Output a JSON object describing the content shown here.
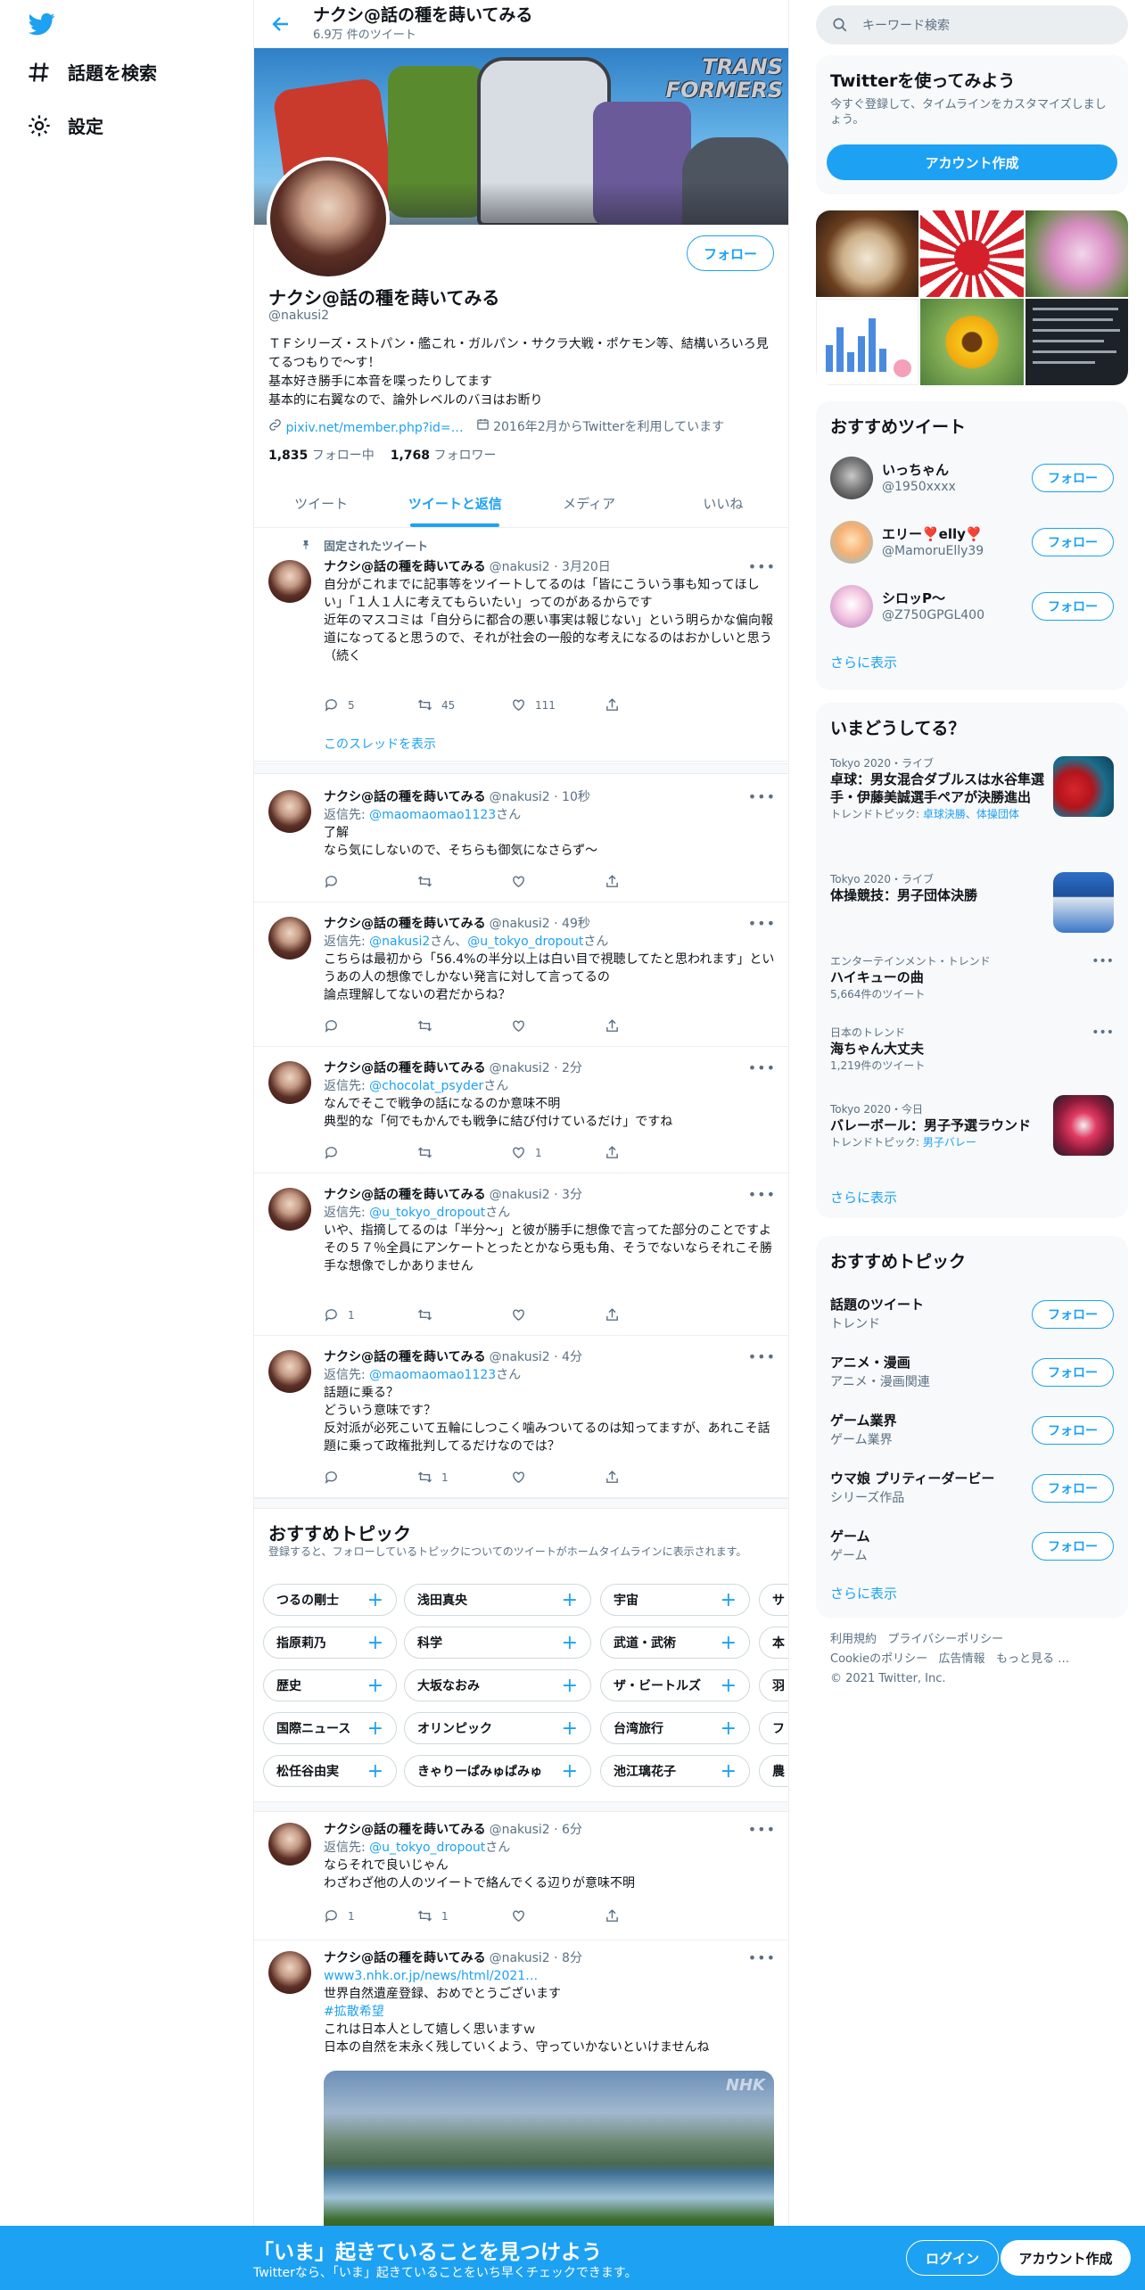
{
  "nav": {
    "explore": "話題を検索",
    "settings": "設定"
  },
  "header": {
    "title": "ナクシ@話の種を蒔いてみる",
    "tweet_count": "6.9万 件のツイート"
  },
  "banner": {
    "logo_line1": "TRANS",
    "logo_line2": "FORMERS"
  },
  "profile": {
    "follow": "フォロー",
    "name": "ナクシ@話の種を蒔いてみる",
    "handle": "@nakusi2",
    "bio": "ＴＦシリーズ・ストパン・艦これ・ガルパン・サクラ大戦・ポケモン等、結構いろいろ見てるつもりで～す！\n基本好き勝手に本音を喋ったりしてます\n基本的に右翼なので、論外レベルのバヨはお断り",
    "link": "pixiv.net/member.php?id=…",
    "joined": "2016年2月からTwitterを利用しています",
    "following_count": "1,835",
    "following_label": "フォロー中",
    "followers_count": "1,768",
    "followers_label": "フォロワー"
  },
  "tabs": [
    "ツイート",
    "ツイートと返信",
    "メディア",
    "いいね"
  ],
  "pinned_label": "固定されたツイート",
  "tweets": [
    {
      "name": "ナクシ@話の種を蒔いてみる",
      "meta": "@nakusi2 · 3月20日",
      "reply_to_label": "",
      "reply_to": "",
      "reply_suffix": "",
      "text": "自分がこれまでに記事等をツイートしてるのは「皆にこういう事も知ってほしい」「１人１人に考えてもらいたい」ってのがあるからです\n近年のマスコミは「自分らに都合の悪い事実は報じない」という明らかな偏向報道になってると思うので、それが社会の一般的な考えになるのはおかしいと思う\n（続く",
      "replies": "5",
      "retweets": "45",
      "likes": "111",
      "thread_link": "このスレッドを表示"
    },
    {
      "name": "ナクシ@話の種を蒔いてみる",
      "meta": "@nakusi2 · 10秒",
      "reply_to_label": "返信先: ",
      "reply_to": "@maomaomao1123",
      "reply_suffix": "さん",
      "text": "了解\nなら気にしないので、そちらも御気になさらず～",
      "replies": "",
      "retweets": "",
      "likes": ""
    },
    {
      "name": "ナクシ@話の種を蒔いてみる",
      "meta": "@nakusi2 · 49秒",
      "reply_to_label": "返信先: ",
      "reply_to": "@nakusi2",
      "reply_suffix": "さん、",
      "reply_to2": "@u_tokyo_dropout",
      "reply_suffix2": "さん",
      "text": "こちらは最初から「56.4%の半分以上は白い目で視聴してたと思われます」というあの人の想像でしかない発言に対して言ってるの\n論点理解してないの君だからね？",
      "replies": "",
      "retweets": "",
      "likes": ""
    },
    {
      "name": "ナクシ@話の種を蒔いてみる",
      "meta": "@nakusi2 · 2分",
      "reply_to_label": "返信先: ",
      "reply_to": "@chocolat_psyder",
      "reply_suffix": "さん",
      "text": "なんでそこで戦争の話になるのか意味不明\n典型的な「何でもかんでも戦争に結び付けているだけ」ですね",
      "replies": "",
      "retweets": "",
      "likes": "1"
    },
    {
      "name": "ナクシ@話の種を蒔いてみる",
      "meta": "@nakusi2 · 3分",
      "reply_to_label": "返信先: ",
      "reply_to": "@u_tokyo_dropout",
      "reply_suffix": "さん",
      "text": "いや、指摘してるのは「半分～」と彼が勝手に想像で言ってた部分のことですよ\nその５７％全員にアンケートとったとかなら兎も角、そうでないならそれこそ勝手な想像でしかありません",
      "replies": "1",
      "retweets": "",
      "likes": ""
    },
    {
      "name": "ナクシ@話の種を蒔いてみる",
      "meta": "@nakusi2 · 4分",
      "reply_to_label": "返信先: ",
      "reply_to": "@maomaomao1123",
      "reply_suffix": "さん",
      "text": "話題に乗る？\nどういう意味です？\n反対派が必死こいて五輪にしつこく噛みついてるのは知ってますが、あれこそ話題に乗って政権批判してるだけなのでは？",
      "replies": "",
      "retweets": "1",
      "likes": ""
    },
    {
      "name": "ナクシ@話の種を蒔いてみる",
      "meta": "@nakusi2 · 6分",
      "reply_to_label": "返信先: ",
      "reply_to": "@u_tokyo_dropout",
      "reply_suffix": "さん",
      "text": "ならそれで良いじゃん\nわざわざ他の人のツイートで絡んでくる辺りが意味不明",
      "replies": "1",
      "retweets": "1",
      "likes": ""
    },
    {
      "name": "ナクシ@話の種を蒔いてみる",
      "meta": "@nakusi2 · 8分",
      "link": "www3.nhk.or.jp/news/html/2021…",
      "hashtag": "#拡散希望",
      "text": "世界自然遺産登録、おめでとうございます",
      "text2": "これは日本人として嬉しく思いますｗ\n日本の自然を末永く残していくよう、守っていかないといけませんね",
      "media_mark": "NHK"
    }
  ],
  "topics": {
    "title": "おすすめトピック",
    "desc": "登録すると、フォローしているトピックについてのツイートがホームタイムラインに表示されます。",
    "rows": [
      [
        "つるの剛士",
        "浅田真央",
        "宇宙",
        "サ"
      ],
      [
        "指原莉乃",
        "科学",
        "武道・武術",
        "本"
      ],
      [
        "歴史",
        "大坂なおみ",
        "ザ・ビートルズ",
        "羽"
      ],
      [
        "国際ニュース",
        "オリンピック",
        "台湾旅行",
        "フ"
      ],
      [
        "松任谷由実",
        "きゃりーぱみゅぱみゅ",
        "池江璃花子",
        "農"
      ]
    ]
  },
  "right": {
    "search_placeholder": "キーワード検索",
    "join": {
      "title": "Twitterを使ってみよう",
      "desc": "今すぐ登録して、タイムラインをカスタマイズしましょう。",
      "button": "アカウント作成"
    },
    "who_title": "おすすめツイート",
    "who": [
      {
        "name": "いっちゃん",
        "handle": "@1950xxxx",
        "follow": "フォロー"
      },
      {
        "name": "エリー❣️elly❣️",
        "handle": "@MamoruElly39",
        "follow": "フォロー"
      },
      {
        "name": "シロッP〜",
        "handle": "@Z750GPGL400",
        "follow": "フォロー"
      }
    ],
    "show_more": "さらに表示",
    "trends_title": "いまどうしてる？",
    "trends": [
      {
        "ctx": "Tokyo 2020・ライブ",
        "title": "卓球：男女混合ダブルスは水谷隼選手・伊藤美誠選手ペアが決勝進出",
        "sub_prefix": "トレンドトピック: ",
        "sub_link": "卓球決勝、体操団体"
      },
      {
        "ctx": "Tokyo 2020・ライブ",
        "title": "体操競技：男子団体決勝",
        "sub_prefix": "",
        "sub_link": ""
      },
      {
        "ctx": "エンターテインメント・トレンド",
        "title": "ハイキューの曲",
        "sub": "5,664件のツイート"
      },
      {
        "ctx": "日本のトレンド",
        "title": "海ちゃん大丈夫",
        "sub": "1,219件のツイート"
      },
      {
        "ctx": "Tokyo 2020・今日",
        "title": "バレーボール：男子予選ラウンド",
        "sub_prefix": "トレンドトピック: ",
        "sub_link": "男子バレー"
      }
    ],
    "topics_title": "おすすめトピック",
    "topics": [
      {
        "name": "話題のツイート",
        "cat": "トレンド"
      },
      {
        "name": "アニメ・漫画",
        "cat": "アニメ・漫画関連"
      },
      {
        "name": "ゲーム業界",
        "cat": "ゲーム業界"
      },
      {
        "name": "ウマ娘 プリティーダービー",
        "cat": "シリーズ作品"
      },
      {
        "name": "ゲーム",
        "cat": "ゲーム"
      }
    ],
    "footer": [
      "利用規約",
      "プライバシーポリシー",
      "Cookieのポリシー",
      "広告情報",
      "もっと見る …",
      "© 2021 Twitter, Inc."
    ]
  },
  "bottom": {
    "title": "「いま」起きていることを見つけよう",
    "sub": "Twitterなら、「いま」起きていることをいち早くチェックできます。",
    "login": "ログイン",
    "signup": "アカウント作成"
  },
  "colors": {
    "accent": "#1da1f2",
    "muted": "#5b7083",
    "border": "#ebeef0"
  }
}
